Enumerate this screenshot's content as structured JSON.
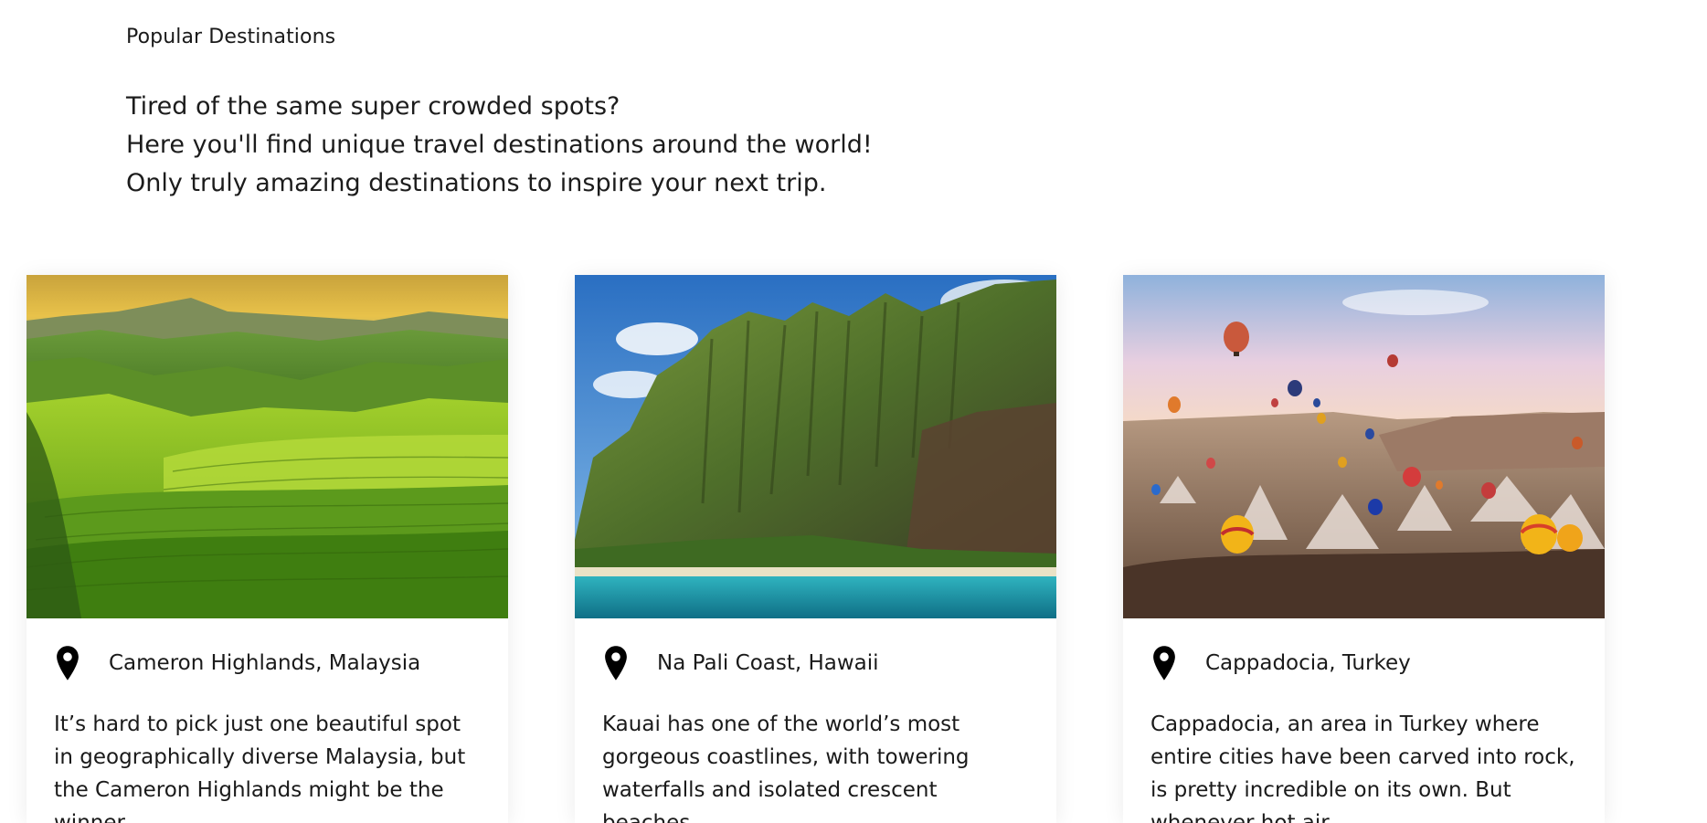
{
  "section": {
    "label": "Popular Destinations"
  },
  "intro": {
    "lines": [
      "Tired of the same super crowded spots?",
      "Here you'll find unique travel destinations around the world!",
      "Only truly amazing destinations to inspire your next trip."
    ]
  },
  "cards": [
    {
      "image_icon": "tea-plantation-hills-photo",
      "location": "Cameron Highlands, Malaysia",
      "description": "It’s hard to pick just one beautiful spot in geographically diverse Malaysia, but the Cameron Highlands might be the winner."
    },
    {
      "image_icon": "sea-cliffs-coastline-photo",
      "location": "Na Pali Coast, Hawaii",
      "description": "Kauai has one of the world’s most gorgeous coastlines, with towering waterfalls and isolated crescent beaches."
    },
    {
      "image_icon": "hot-air-balloons-valley-photo",
      "location": "Cappadocia, Turkey",
      "description": "Cappadocia, an area in Turkey where entire cities have been carved into rock, is pretty incredible on its own. But whenever hot air"
    }
  ],
  "colors": {
    "text": "#1a1a1a",
    "background": "#ffffff",
    "pin": "#000000"
  }
}
